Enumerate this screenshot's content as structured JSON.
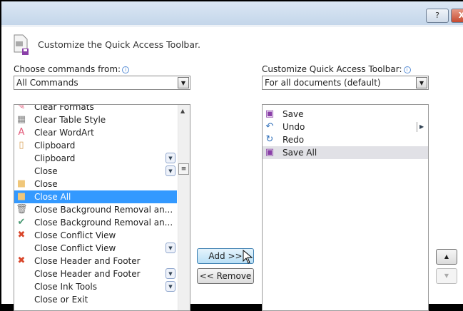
{
  "titlebar": {
    "help": "?",
    "close": "X"
  },
  "header": {
    "title": "Customize the Quick Access Toolbar."
  },
  "left": {
    "label": "Choose commands from:",
    "dropdown_value": "All Commands",
    "items": [
      {
        "label": "Clear Formats",
        "icon": "clear-formats-icon",
        "glyph": "✎",
        "color": "#e35a7a",
        "sub": false
      },
      {
        "label": "Clear Table Style",
        "icon": "clear-table-style-icon",
        "glyph": "▦",
        "color": "#888",
        "sub": false
      },
      {
        "label": "Clear WordArt",
        "icon": "clear-wordart-icon",
        "glyph": "A",
        "color": "#e35a7a",
        "sub": false
      },
      {
        "label": "Clipboard",
        "icon": "clipboard-icon",
        "glyph": "▯",
        "color": "#d9a35a",
        "sub": false
      },
      {
        "label": "Clipboard",
        "icon": "",
        "glyph": "",
        "color": "",
        "sub": true
      },
      {
        "label": "Close",
        "icon": "",
        "glyph": "",
        "color": "",
        "sub": true
      },
      {
        "label": "Close",
        "icon": "folder-icon",
        "glyph": "■",
        "color": "#f0c77a",
        "sub": false
      },
      {
        "label": "Close All",
        "icon": "folder-icon",
        "glyph": "■",
        "color": "#f0c77a",
        "sub": false,
        "selected": true
      },
      {
        "label": "Close Background Removal an...",
        "icon": "trash-icon",
        "glyph": "🗑",
        "color": "#777",
        "sub": false
      },
      {
        "label": "Close Background Removal an...",
        "icon": "checkmark-icon",
        "glyph": "✔",
        "color": "#4a9a74",
        "sub": false
      },
      {
        "label": "Close Conflict View",
        "icon": "red-x-icon",
        "glyph": "✖",
        "color": "#d9472b",
        "sub": false
      },
      {
        "label": "Close Conflict View",
        "icon": "",
        "glyph": "",
        "color": "",
        "sub": true
      },
      {
        "label": "Close Header and Footer",
        "icon": "red-x-icon",
        "glyph": "✖",
        "color": "#d9472b",
        "sub": false
      },
      {
        "label": "Close Header and Footer",
        "icon": "",
        "glyph": "",
        "color": "",
        "sub": true
      },
      {
        "label": "Close Ink Tools",
        "icon": "",
        "glyph": "",
        "color": "",
        "sub": true
      },
      {
        "label": "Close or Exit",
        "icon": "",
        "glyph": "",
        "color": "",
        "sub": false
      }
    ]
  },
  "right": {
    "label": "Customize Quick Access Toolbar:",
    "dropdown_value": "For all documents (default)",
    "items": [
      {
        "label": "Save",
        "icon": "save-icon",
        "glyph": "▣",
        "color": "#8a3fa8"
      },
      {
        "label": "Undo",
        "icon": "undo-icon",
        "glyph": "↶",
        "color": "#2f6fba"
      },
      {
        "label": "Redo",
        "icon": "redo-icon",
        "glyph": "↻",
        "color": "#2f6fba"
      },
      {
        "label": "Save All",
        "icon": "save-all-icon",
        "glyph": "▣",
        "color": "#8a3fa8",
        "highlighted": true
      }
    ]
  },
  "buttons": {
    "add": "Add >>",
    "remove": "<< Remove",
    "up": "▲",
    "down": "▼"
  }
}
